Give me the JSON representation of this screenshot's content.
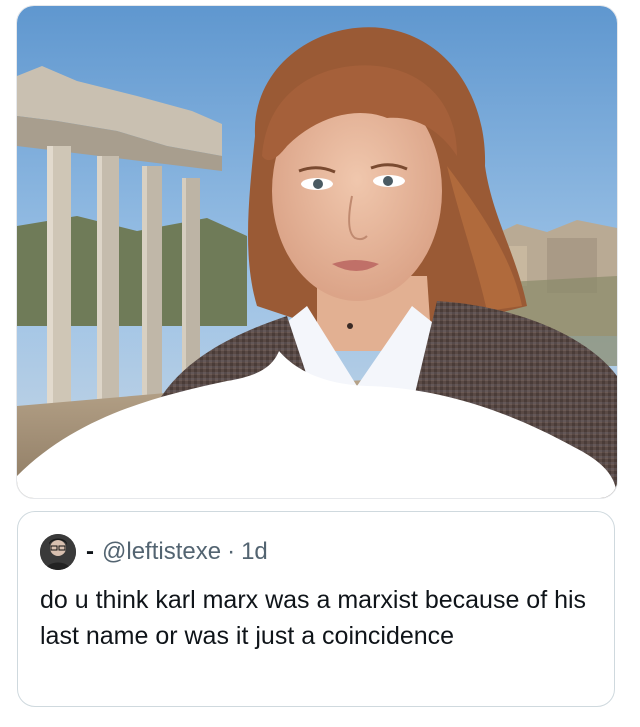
{
  "media": {
    "icon": "photo-of-woman-at-roman-forum"
  },
  "quote": {
    "avatar_icon": "user-avatar-icon",
    "dash": "-",
    "handle": "@leftistexe",
    "separator": "·",
    "time": "1d",
    "text": "do u think karl marx was a marxist because of his last name or was it just a coincidence"
  },
  "colors": {
    "text_primary": "#0f1419",
    "text_secondary": "#536471",
    "border": "#cfd9de",
    "sky": "#7fb0dc"
  }
}
